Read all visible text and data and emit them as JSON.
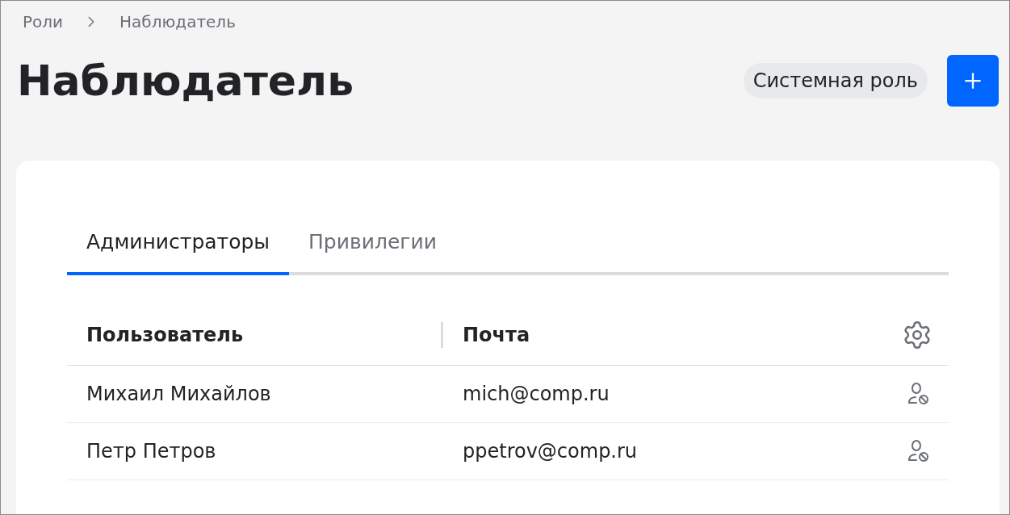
{
  "breadcrumbs": [
    {
      "label": "Роли"
    },
    {
      "label": "Наблюдатель"
    }
  ],
  "title": "Наблюдатель",
  "role_badge": "Системная роль",
  "tabs": [
    {
      "label": "Администраторы",
      "selected": true
    },
    {
      "label": "Привилегии",
      "selected": false
    }
  ],
  "table": {
    "columns": [
      "Пользователь",
      "Почта"
    ],
    "rows": [
      {
        "user": "Михаил Михайлов",
        "email": "mich@comp.ru"
      },
      {
        "user": "Петр Петров",
        "email": "ppetrov@comp.ru"
      }
    ]
  }
}
